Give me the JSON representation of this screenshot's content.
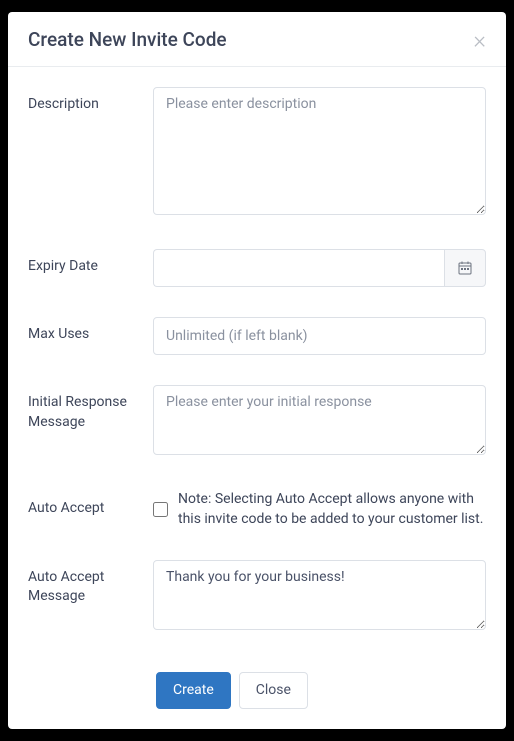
{
  "header": {
    "title": "Create New Invite Code"
  },
  "form": {
    "description": {
      "label": "Description",
      "placeholder": "Please enter description",
      "value": ""
    },
    "expiryDate": {
      "label": "Expiry Date",
      "value": ""
    },
    "maxUses": {
      "label": "Max Uses",
      "placeholder": "Unlimited (if left blank)",
      "value": ""
    },
    "initialResponse": {
      "label": "Initial Response Message",
      "placeholder": "Please enter your initial response",
      "value": ""
    },
    "autoAccept": {
      "label": "Auto Accept",
      "note": "Note: Selecting Auto Accept allows anyone with this invite code to be added to your customer list.",
      "checked": false
    },
    "autoAcceptMessage": {
      "label": "Auto Accept Message",
      "value": "Thank you for your business!"
    }
  },
  "footer": {
    "create": "Create",
    "close": "Close"
  }
}
